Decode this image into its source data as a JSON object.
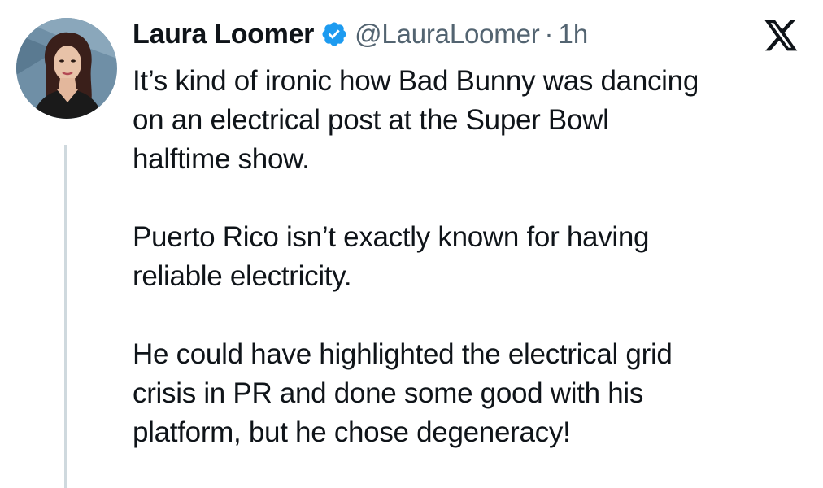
{
  "tweet": {
    "author": {
      "display_name": "Laura Loomer",
      "handle": "@LauraLoomer",
      "verified": true,
      "verified_color": "#1d9bf0",
      "avatar_icon": "profile-photo"
    },
    "separator": "·",
    "time": "1h",
    "brand_icon": "x-logo",
    "body": {
      "paragraphs": [
        {
          "lines": [
            "It’s kind of ironic how Bad Bunny was dancing",
            "on an electrical post at the Super Bowl",
            "halftime show."
          ]
        },
        {
          "lines": [
            "Puerto Rico isn’t exactly known for having",
            "reliable electricity."
          ]
        },
        {
          "lines": [
            "He could have highlighted the electrical grid",
            "crisis in PR and done some good with his",
            "platform, but he chose degeneracy!"
          ]
        }
      ]
    }
  }
}
